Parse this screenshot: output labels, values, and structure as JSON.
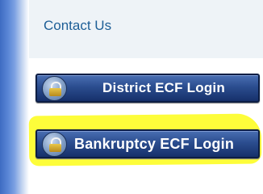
{
  "sidebar": {
    "links": {
      "contact_us": "Contact Us"
    }
  },
  "login_buttons": {
    "district_label": "District ECF Login",
    "bankruptcy_label": "Bankruptcy ECF Login",
    "icon": "lock-icon"
  },
  "colors": {
    "link": "#1d5e96",
    "button_bg": "#2b4d8f",
    "highlight": "#fdfd3a",
    "sidebar_bg": "#eef3f7"
  }
}
